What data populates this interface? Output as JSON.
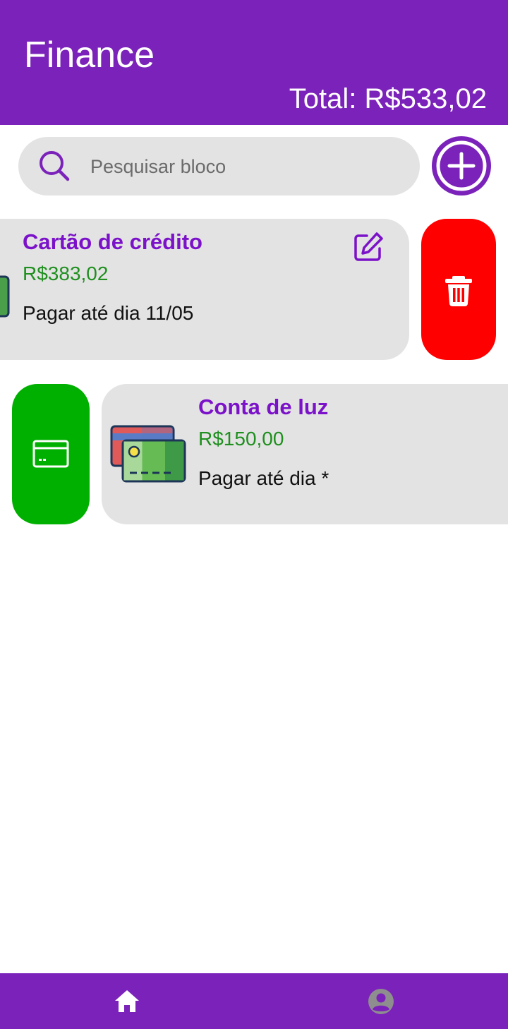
{
  "header": {
    "title": "Finance",
    "total": "Total: R$533,02"
  },
  "search": {
    "placeholder": "Pesquisar bloco",
    "value": "",
    "icon": "search-icon"
  },
  "add_button": {
    "icon": "plus-circle-icon"
  },
  "cards": [
    {
      "title": "Cartão de crédito",
      "amount": "R$383,02",
      "due": "Pagar até dia 11/05",
      "swipe_state": "swiped-left",
      "actions": [
        "edit-icon",
        "trash-icon"
      ]
    },
    {
      "title": "Conta de luz",
      "amount": "R$150,00",
      "due": "Pagar até dia *",
      "swipe_state": "swiped-right",
      "actions": [
        "credit-card-icon"
      ]
    }
  ],
  "bottom_nav": {
    "items": [
      {
        "icon": "home-icon",
        "active": true
      },
      {
        "icon": "account-circle-icon",
        "active": false
      }
    ]
  },
  "colors": {
    "primary": "#7B22BA",
    "title_purple": "#7B12C9",
    "amount_green": "#1f8f1f",
    "delete_red": "#ff0000",
    "pay_green": "#00b000",
    "card_bg": "#e3e3e3",
    "inactive_icon": "#8e8e8e"
  }
}
